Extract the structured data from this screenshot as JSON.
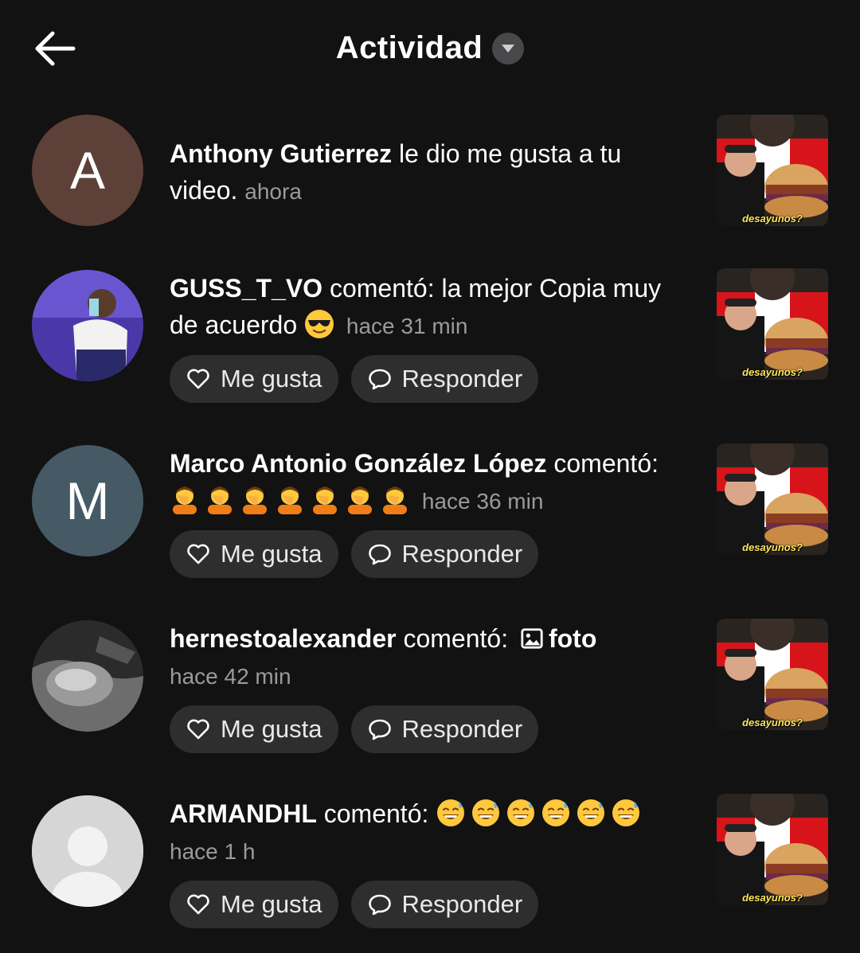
{
  "header": {
    "title": "Actividad"
  },
  "activity": [
    {
      "avatar_type": "letter",
      "avatar_letter": "A",
      "avatar_color": "#5d4037",
      "user": "Anthony Gutierrez",
      "action": " le dio me gusta a tu video.",
      "extra": "",
      "time": "ahora",
      "thumb_caption": "desayunos?",
      "has_actions": false
    },
    {
      "avatar_type": "photo-person",
      "avatar_letter": "",
      "avatar_color": "#3b2d7a",
      "user": "GUSS_T_VO",
      "action": " comentó: la mejor Copia muy de acuerdo",
      "extra": "sunglasses-emoji",
      "time": "hace 31 min",
      "thumb_caption": "desayunos?",
      "has_actions": true
    },
    {
      "avatar_type": "letter",
      "avatar_letter": "M",
      "avatar_color": "#455a64",
      "user": "Marco Antonio González López",
      "action": " comentó:",
      "extra": "facepalm-emoji",
      "time": "hace 36 min",
      "thumb_caption": "desayunos?",
      "has_actions": true
    },
    {
      "avatar_type": "photo-bw",
      "avatar_letter": "",
      "avatar_color": "#1a1a1a",
      "user": "hernestoalexander",
      "action": " comentó:",
      "extra": "foto",
      "time": "hace 42 min",
      "thumb_caption": "desayunos?",
      "has_actions": true
    },
    {
      "avatar_type": "default",
      "avatar_letter": "",
      "avatar_color": "#d6d6d6",
      "user": "ARMANDHL",
      "action": " comentó:",
      "extra": "sweat-smile-emoji",
      "time": "hace 1 h",
      "thumb_caption": "desayunos?",
      "has_actions": true
    }
  ],
  "actions": {
    "like_label": "Me gusta",
    "reply_label": "Responder"
  },
  "colors": {
    "background": "#121212",
    "pill": "#2e2e2e",
    "time": "#9a9a9a"
  }
}
